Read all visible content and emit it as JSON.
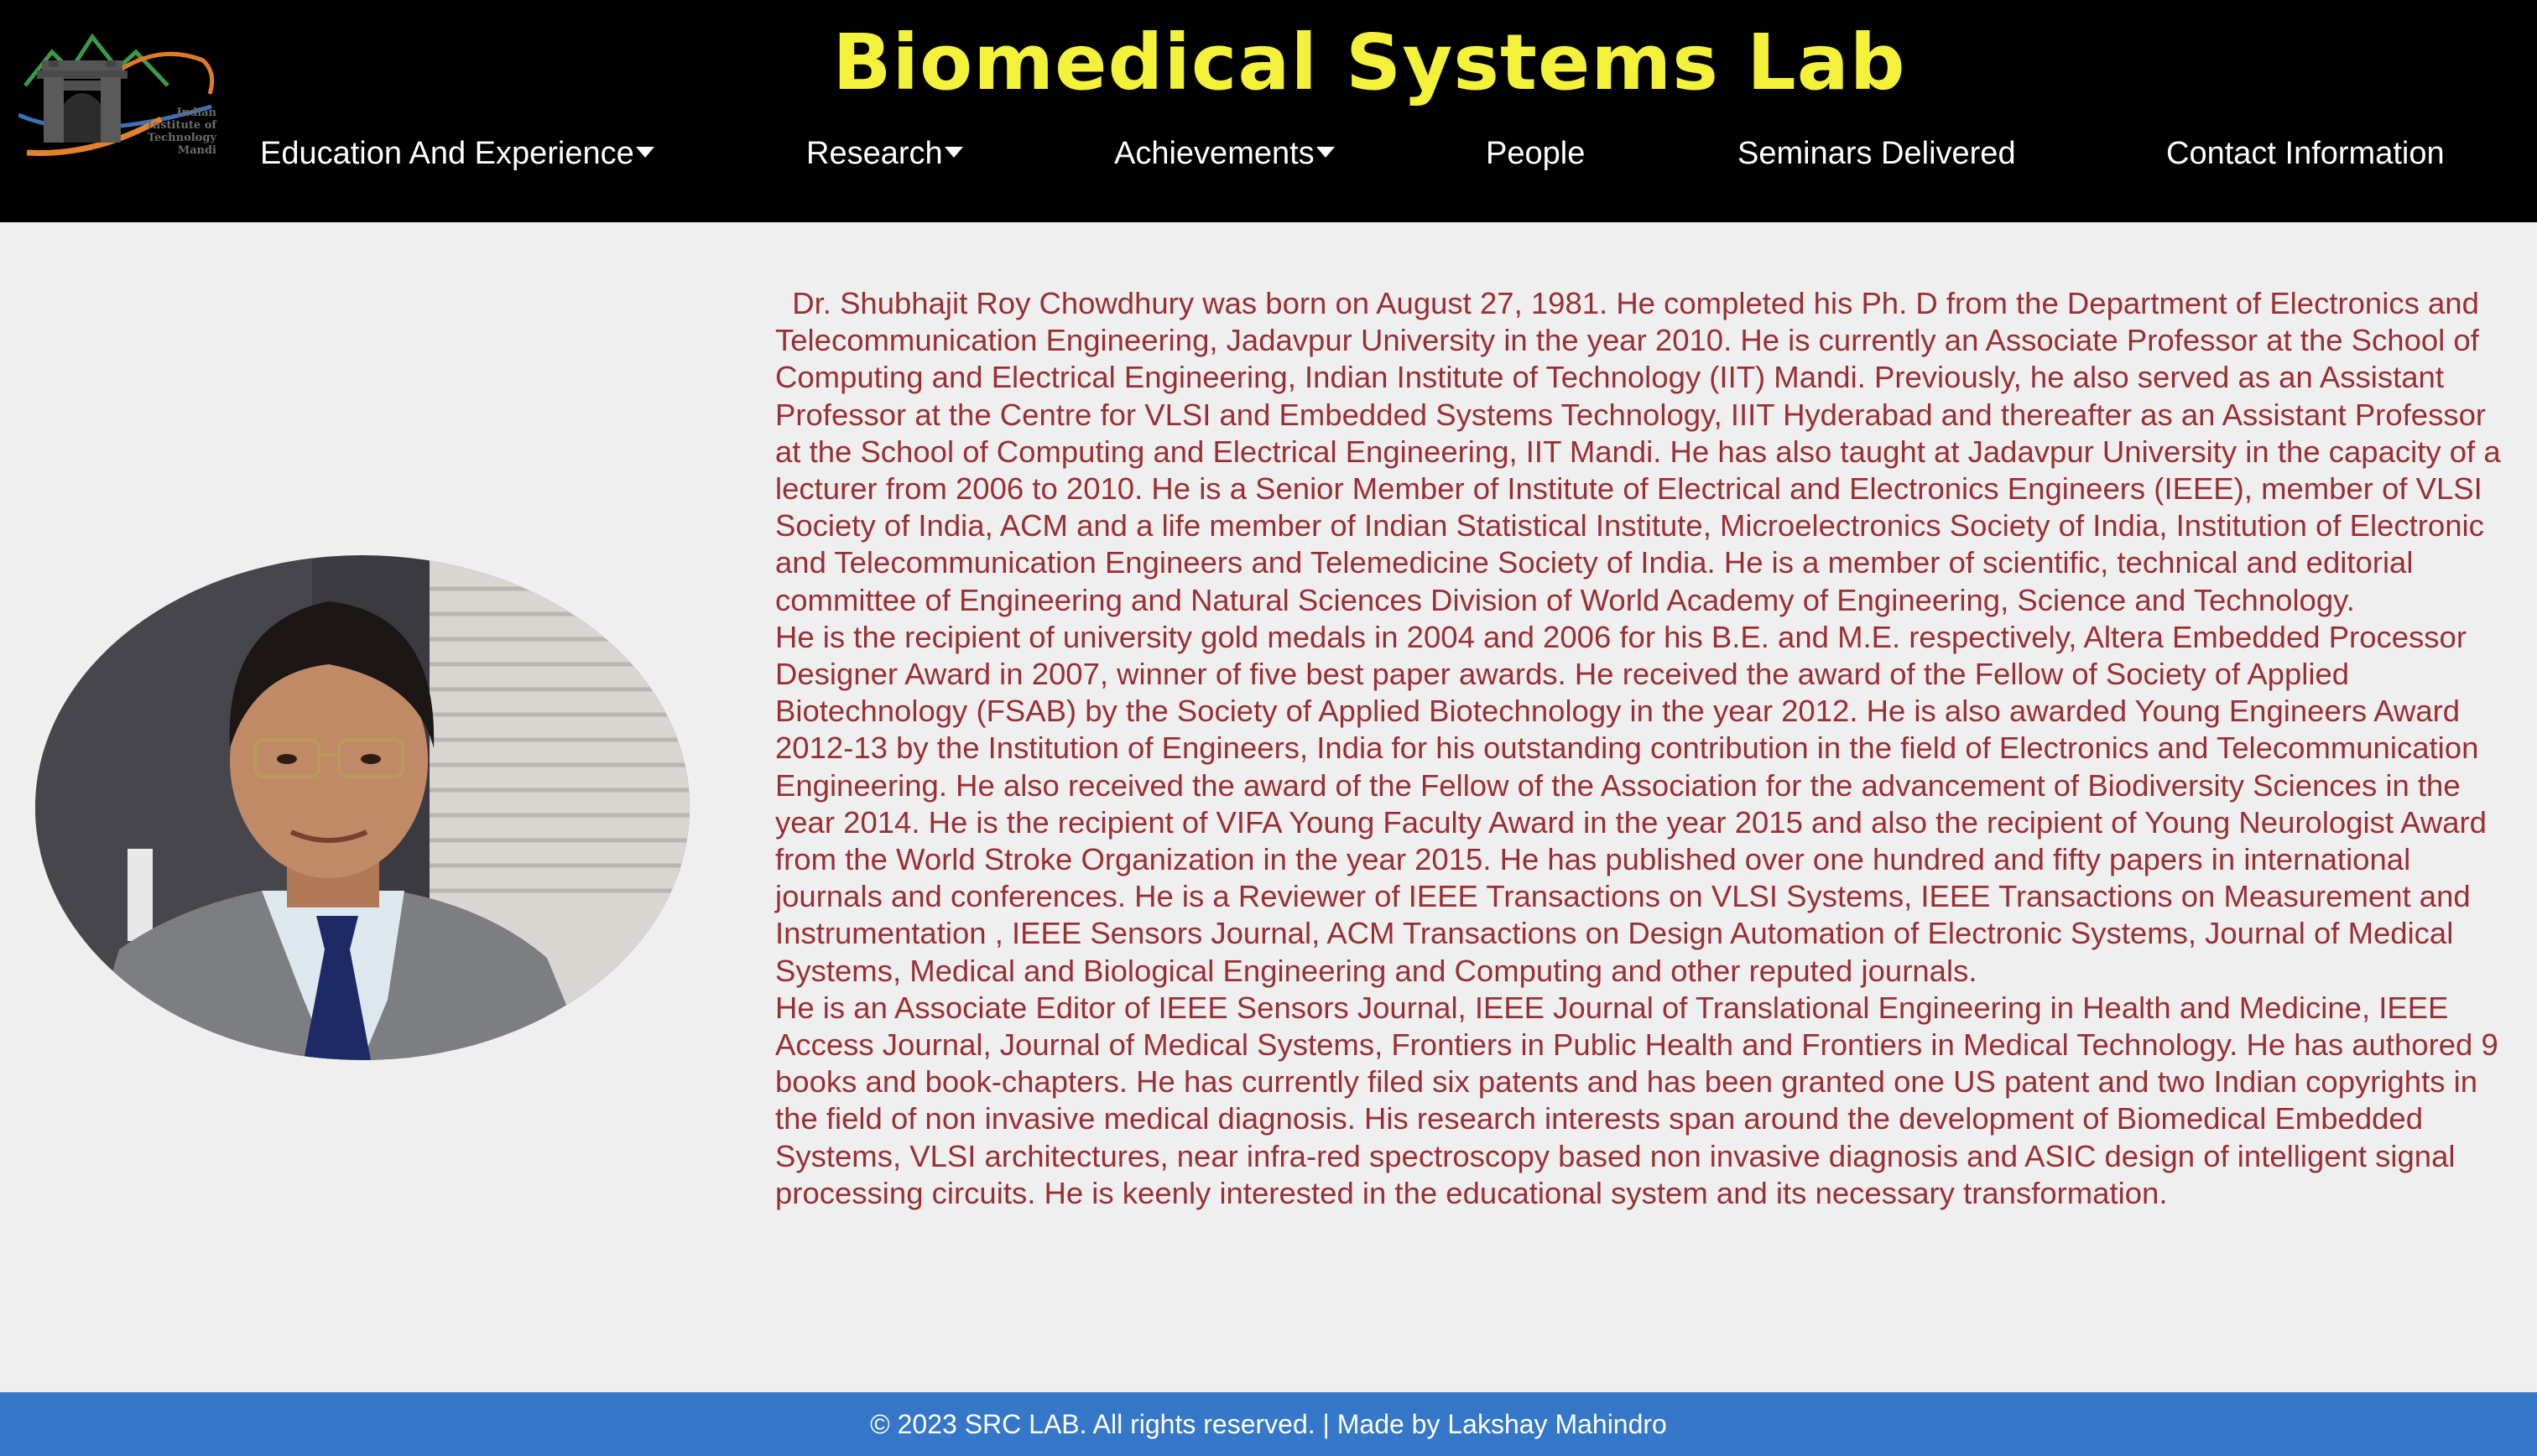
{
  "header": {
    "title": "Biomedical Systems Lab",
    "logo_text": [
      "Indian",
      "Institute of",
      "Technology",
      "Mandi"
    ],
    "background": "#000000",
    "title_color": "#f3f13a"
  },
  "nav": {
    "items": [
      {
        "label": "Education And Experience",
        "dropdown": true
      },
      {
        "label": "Research",
        "dropdown": true
      },
      {
        "label": "Achievements",
        "dropdown": true
      },
      {
        "label": "People",
        "dropdown": false
      },
      {
        "label": "Seminars Delivered",
        "dropdown": false
      },
      {
        "label": "Contact Information",
        "dropdown": false
      }
    ]
  },
  "bio": {
    "paragraphs": [
      "  Dr. Shubhajit Roy Chowdhury was born on August 27, 1981. He completed his Ph. D from the Department of Electronics and Telecommunication Engineering, Jadavpur University in the year 2010. He is currently an Associate Professor at the School of Computing and Electrical Engineering, Indian Institute of Technology (IIT) Mandi. Previously, he also served as an Assistant Professor at the Centre for VLSI and Embedded Systems Technology, IIIT Hyderabad and thereafter as an Assistant Professor at the School of Computing and Electrical Engineering, IIT Mandi. He has also taught at Jadavpur University in the capacity of a lecturer from 2006 to 2010. He is a Senior Member of Institute of Electrical and Electronics Engineers (IEEE), member of VLSI Society of India, ACM and a life member of Indian Statistical Institute, Microelectronics Society of India, Institution of Electronic and Telecommunication Engineers and Telemedicine Society of India. He is a member of scientific, technical and editorial committee of Engineering and Natural Sciences Division of World Academy of Engineering, Science and Technology.",
      "He is the recipient of university gold medals in 2004 and 2006 for his B.E. and M.E. respectively, Altera Embedded Processor Designer Award in 2007, winner of five best paper awards. He received the award of the Fellow of Society of Applied Biotechnology (FSAB) by the Society of Applied Biotechnology in the year 2012. He is also awarded Young Engineers Award 2012-13 by the Institution of Engineers, India for his outstanding contribution in the field of Electronics and Telecommunication Engineering. He also received the award of the Fellow of the Association for the advancement of Biodiversity Sciences in the year 2014. He is the recipient of VIFA Young Faculty Award in the year 2015 and also the recipient of Young Neurologist Award from the World Stroke Organization in the year 2015. He has published over one hundred and fifty papers in international journals and conferences. He is a Reviewer of IEEE Transactions on VLSI Systems, IEEE Transactions on Measurement and Instrumentation , IEEE Sensors Journal, ACM Transactions on Design Automation of Electronic Systems, Journal of Medical Systems, Medical and Biological Engineering and Computing and other reputed journals.",
      "He is an Associate Editor of IEEE Sensors Journal, IEEE Journal of Translational Engineering in Health and Medicine, IEEE Access Journal, Journal of Medical Systems, Frontiers in Public Health and Frontiers in Medical Technology. He has authored 9 books and book-chapters. He has currently filed six patents and has been granted one US patent and two Indian copyrights in the field of non invasive medical diagnosis. His research interests span around the development of Biomedical Embedded Systems, VLSI architectures, near infra-red spectroscopy based non invasive diagnosis and ASIC design of intelligent signal processing circuits. He is keenly interested in the educational system and its necessary transformation."
    ],
    "text_color": "#9a2f33"
  },
  "photo": {
    "icon": "profile-photo"
  },
  "footer": {
    "text": "© 2023 SRC LAB. All rights reserved. | Made by Lakshay Mahindro",
    "background": "#3577c8"
  }
}
